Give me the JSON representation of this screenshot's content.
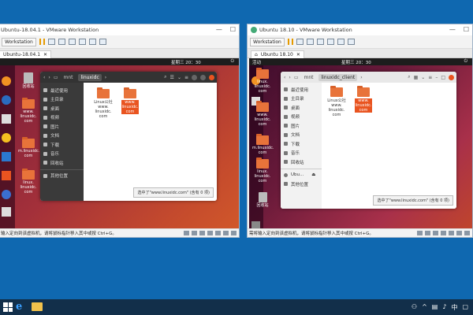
{
  "desktop": {
    "bg": "#0f68b0"
  },
  "left": {
    "vm_title": "Ubuntu-18.04.1 - VMware Workstation",
    "workstation_label": "Workstation",
    "tab_label": "Ubuntu-18.04.1",
    "clock": "星期三 20：30",
    "status_text": "输入定向到该虚拟机，请将鼠标指针移入其中或按 Ctrl+G。",
    "path": [
      "mnt",
      "linuxidc"
    ],
    "sidebar": [
      "最近使用",
      "主目录",
      "桌面",
      "视频",
      "图片",
      "文档",
      "下载",
      "音乐",
      "回收站",
      "其他位置"
    ],
    "files": [
      {
        "name": "Linux公社\nwww.\nlinuxidc.\ncom",
        "selected": false
      },
      {
        "name": "www.\nlinuxidc.\ncom",
        "selected": true
      }
    ],
    "selection_status": "选中了\"www.linuxidc.com\" (含有 0 项)",
    "desktop_icons": [
      "回收站",
      "www.\nlinuxidc.\ncom",
      "m.linuxidc.\ncom",
      "linux.\nlinuxidc.\ncom"
    ]
  },
  "right": {
    "vm_title": "Ubuntu 18.10 - VMware Workstation",
    "workstation_label": "Workstation",
    "tab_label": "Ubuntu 18.10",
    "activities": "活动",
    "clock": "星期三 20：30",
    "status_text": "需将输入定向到该虚拟机，请将鼠标指针移入其中或按 Ctrl+G。",
    "path": [
      "mnt",
      "linuxidc_client"
    ],
    "sidebar": [
      "最近使用",
      "主目录",
      "桌面",
      "视频",
      "图片",
      "文档",
      "下载",
      "音乐",
      "回收站",
      "Ubu...",
      "其他位置"
    ],
    "files": [
      {
        "name": "Linux公社\nwww.\nlinuxidc.\ncom",
        "selected": false
      },
      {
        "name": "www.\nlinuxidc.\ncom",
        "selected": true
      }
    ],
    "selection_status": "选中了\"www.linuxidc.com\" (含有 0 项)",
    "desktop_icons": [
      "linux.\nlinuxidc.\ncom",
      "www.\nlinuxidc.\ncom",
      "m.linuxidc.\ncom",
      "linux.\nlinuxidc.\ncom",
      "回收站"
    ]
  },
  "taskbar": {
    "icons": [
      "start-icon",
      "ie-icon",
      "explorer-icon"
    ]
  }
}
